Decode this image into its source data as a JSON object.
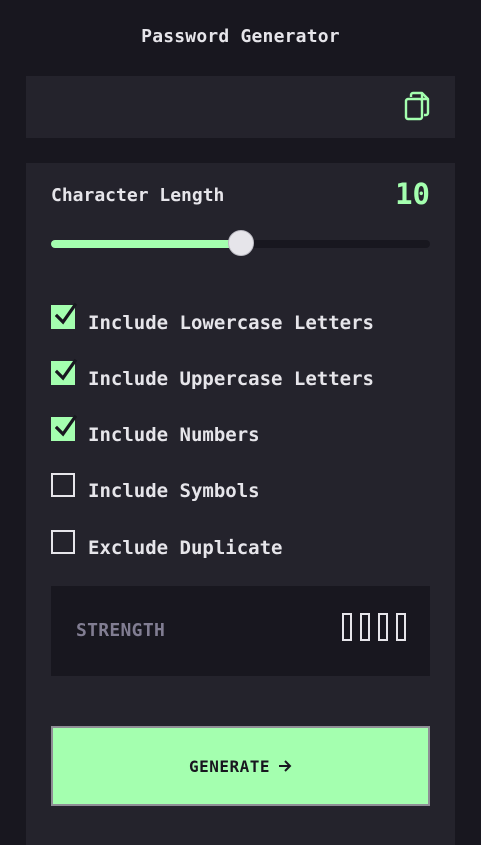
{
  "app": {
    "title": "Password Generator"
  },
  "output": {
    "password": "",
    "copy_icon": "copy-icon"
  },
  "settings": {
    "length_label": "Character Length",
    "length_value": "10",
    "length_min": 0,
    "length_max": 20,
    "length_fraction": 0.5,
    "options": [
      {
        "label": "Include Lowercase Letters",
        "checked": true
      },
      {
        "label": "Include Uppercase Letters",
        "checked": true
      },
      {
        "label": "Include Numbers",
        "checked": true
      },
      {
        "label": "Include Symbols",
        "checked": false
      },
      {
        "label": "Exclude Duplicate",
        "checked": false
      }
    ]
  },
  "strength": {
    "label": "STRENGTH",
    "bars_total": 4,
    "bars_filled": 0
  },
  "generate": {
    "label": "GENERATE",
    "icon": "arrow-right-icon"
  },
  "colors": {
    "background": "#18171f",
    "panel": "#24232c",
    "accent": "#a4ffaf",
    "text": "#e6e5ea",
    "muted": "#817d92"
  }
}
